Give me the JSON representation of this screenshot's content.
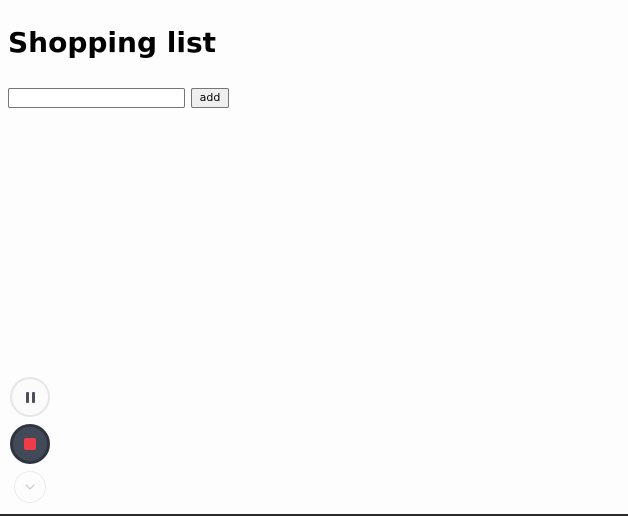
{
  "page": {
    "title": "Shopping list"
  },
  "form": {
    "item_value": "",
    "item_placeholder": "",
    "add_label": "add"
  },
  "recorder": {
    "pause_icon": "pause-icon",
    "stop_icon": "stop-record-icon",
    "collapse_icon": "chevron-down-icon",
    "stop_color": "#ef3b4a"
  }
}
